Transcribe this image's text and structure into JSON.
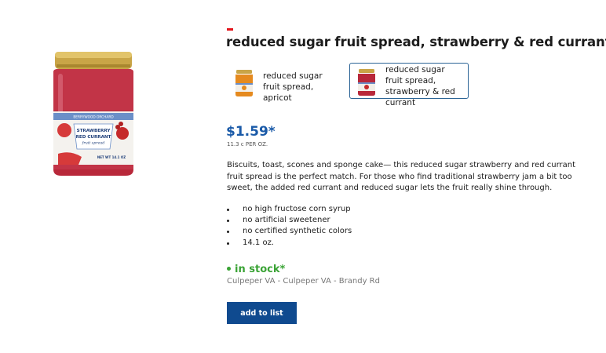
{
  "product": {
    "title": "reduced sugar fruit spread, strawberry & red currant",
    "image_icon": "jar-strawberry-spread",
    "jar_label": {
      "brand": "BERRYWOOD ORCHARD",
      "line1": "STRAWBERRY",
      "line2": "RED CURRANT",
      "line3": "fruit spread",
      "net_wt": "NET WT 14.1 OZ"
    }
  },
  "variants": [
    {
      "label": "reduced sugar fruit spread, apricot",
      "icon": "jar-apricot-thumb",
      "selected": false
    },
    {
      "label": "reduced sugar fruit spread, strawberry & red currant",
      "icon": "jar-strawberry-thumb",
      "selected": true
    }
  ],
  "price": {
    "amount": "$1.59*",
    "unit": "11.3 c PER OZ."
  },
  "description": "Biscuits, toast, scones and sponge cake— this reduced sugar strawberry and red currant fruit spread is the perfect match. For those who find traditional strawberry jam a bit too sweet, the added red currant and reduced sugar lets the fruit really shine through.",
  "features": [
    "no high fructose corn syrup",
    "no artificial sweetener",
    "no certified synthetic colors",
    "14.1 oz."
  ],
  "availability": {
    "status": "in stock*",
    "store": "Culpeper VA - Culpeper VA - Brandy Rd"
  },
  "actions": {
    "add_to_list": "add to list"
  },
  "colors": {
    "accent": "#e3141b",
    "price": "#1a5aa8",
    "in_stock": "#3aa335",
    "button": "#0f4a8f",
    "selected_border": "#2b6496"
  }
}
